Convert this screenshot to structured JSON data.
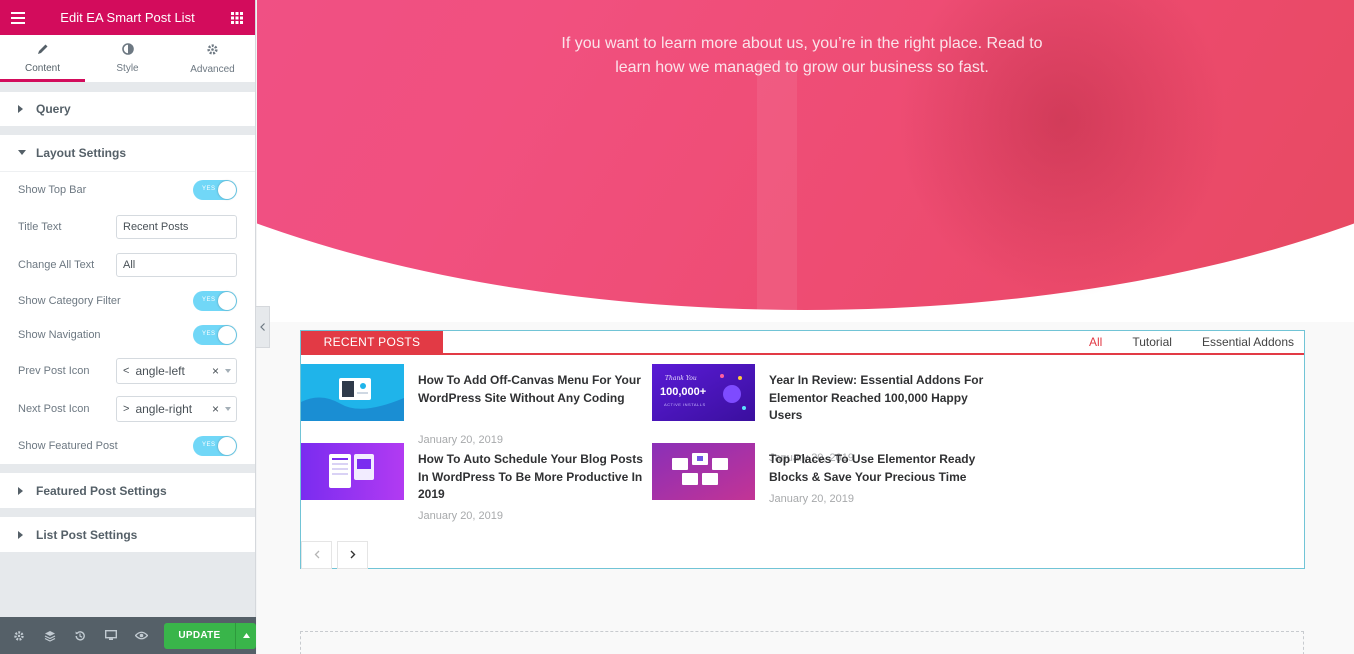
{
  "editor": {
    "title": "Edit EA Smart Post List",
    "tabs": [
      {
        "label": "Content",
        "icon": "pencil-icon",
        "active": true
      },
      {
        "label": "Style",
        "icon": "half-circle-icon",
        "active": false
      },
      {
        "label": "Advanced",
        "icon": "gear-icon",
        "active": false
      }
    ],
    "sections": {
      "query": "Query",
      "layout": "Layout Settings",
      "featured": "Featured Post Settings",
      "list": "List Post Settings"
    },
    "controls": {
      "show_top_bar": {
        "label": "Show Top Bar",
        "toggle": "YES"
      },
      "title_text": {
        "label": "Title Text",
        "value": "Recent Posts"
      },
      "change_all_text": {
        "label": "Change All Text",
        "value": "All"
      },
      "show_category_filter": {
        "label": "Show Category Filter",
        "toggle": "YES"
      },
      "show_navigation": {
        "label": "Show Navigation",
        "toggle": "YES"
      },
      "prev_post_icon": {
        "label": "Prev Post Icon",
        "icon": "<",
        "value": "angle-left",
        "clear": "×"
      },
      "next_post_icon": {
        "label": "Next Post Icon",
        "icon": ">",
        "value": "angle-right",
        "clear": "×"
      },
      "show_featured_post": {
        "label": "Show Featured Post",
        "toggle": "YES"
      }
    },
    "footer": {
      "update_label": "UPDATE"
    },
    "colors": {
      "brand": "#d30c5c",
      "toggle_on": "#71d7f7",
      "update": "#39b54a"
    }
  },
  "page": {
    "intro": "If you want to learn more about us, you’re in the right place. Read to learn how we managed to grow our business so fast.",
    "post_list": {
      "title": "RECENT POSTS",
      "filters": [
        {
          "label": "All",
          "active": true
        },
        {
          "label": "Tutorial",
          "active": false
        },
        {
          "label": "Essential Addons",
          "active": false
        }
      ],
      "posts": [
        {
          "title": "How To Add Off-Canvas Menu For Your WordPress Site Without Any Coding",
          "date": "January 20, 2019"
        },
        {
          "title": "Year In Review: Essential Addons For Elementor Reached 100,000 Happy Users",
          "date": "January 20, 2019"
        },
        {
          "title": "How To Auto Schedule Your Blog Posts In WordPress To Be More Productive In 2019",
          "date": "January 20, 2019"
        },
        {
          "title": "Top Places To Use Elementor Ready Blocks & Save Your Precious Time",
          "date": "January 20, 2019"
        }
      ],
      "thumb_text": {
        "thank_you": "Thank You",
        "count": "100,000+",
        "sub": "ACTIVE INSTALLS"
      },
      "accent": "#e23a45"
    }
  }
}
